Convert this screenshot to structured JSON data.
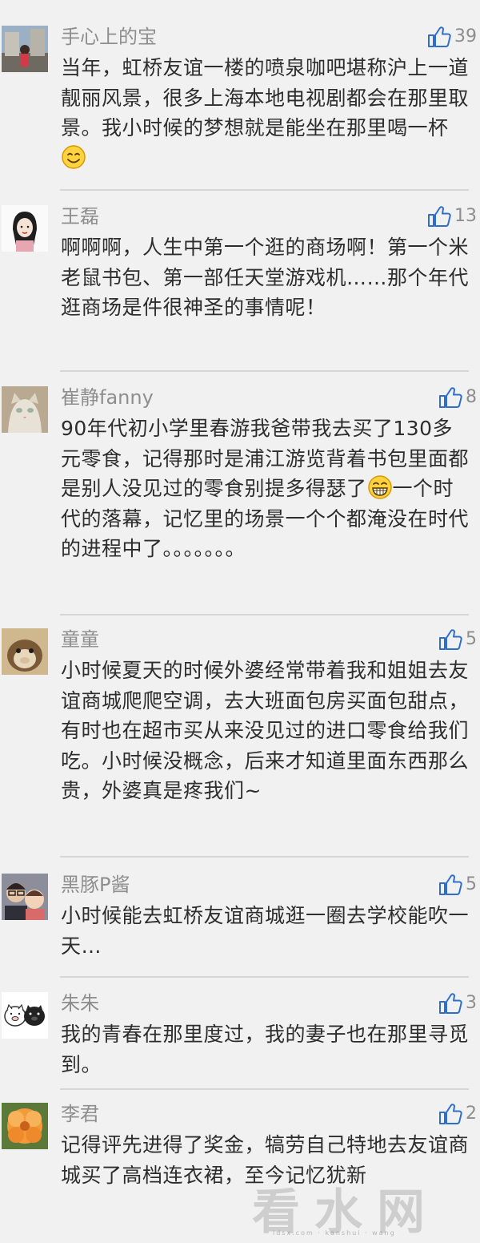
{
  "comments": [
    {
      "username": "手心上的宝",
      "likes": "39",
      "text_before": "当年，虹桥友谊一楼的喷泉咖吧堪称沪上一道靓丽风景，很多上海本地电视剧都会在那里取景。我小时候的梦想就是能坐在那里喝一杯",
      "emoji": "smile-emoji",
      "text_after": ""
    },
    {
      "username": "王磊",
      "likes": "13",
      "text_before": "啊啊啊，人生中第一个逛的商场啊！第一个米老鼠书包、第一部任天堂游戏机……那个年代逛商场是件很神圣的事情呢！",
      "emoji": "",
      "text_after": ""
    },
    {
      "username": "崔静fanny",
      "likes": "8",
      "text_before": "90年代初小学里春游我爸带我去买了130多元零食，记得那时是浦江游览背着书包里面都是别人没见过的零食别提多得瑟了",
      "emoji": "grin-emoji",
      "text_after": "一个时代的落幕，记忆里的场景一个个都淹没在时代的进程中了。。。。。。。"
    },
    {
      "username": "童童",
      "likes": "5",
      "text_before": "小时候夏天的时候外婆经常带着我和姐姐去友谊商城爬爬空调，去大班面包房买面包甜点，有时也在超市买从来没见过的进口零食给我们吃。小时候没概念，后来才知道里面东西那么贵，外婆真是疼我们~",
      "emoji": "",
      "text_after": ""
    },
    {
      "username": "黑豚P酱",
      "likes": "5",
      "text_before": "小时候能去虹桥友谊商城逛一圈去学校能吹一天…",
      "emoji": "",
      "text_after": ""
    },
    {
      "username": "朱朱",
      "likes": "3",
      "text_before": "我的青春在那里度过，我的妻子也在那里寻觅到。",
      "emoji": "",
      "text_after": ""
    },
    {
      "username": "李君",
      "likes": "2",
      "text_before": "记得评先进得了奖金，犒劳自己特地去友谊商城买了高档连衣裙，至今记忆犹新",
      "emoji": "",
      "text_after": ""
    }
  ],
  "watermark": {
    "text": "看水网",
    "subtext": "ldsx.com  ·  kanshui  ·  wang"
  },
  "colors": {
    "background": "#f1f1f1",
    "text": "#2d2d2d",
    "meta": "#8e8e8e",
    "divider": "#d6d6d6",
    "like_icon": "#2f6fc9"
  }
}
